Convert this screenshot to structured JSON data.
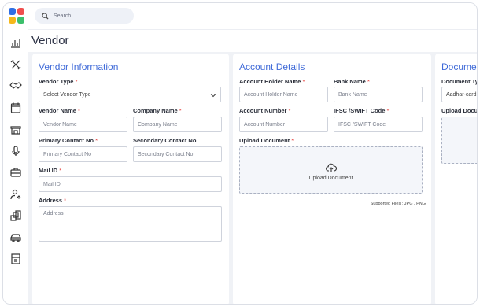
{
  "search": {
    "placeholder": "Search..."
  },
  "page": {
    "title": "Vendor"
  },
  "sidebar": {
    "icons": [
      "bar-chart-icon",
      "tools-icon",
      "handshake-icon",
      "calendar-icon",
      "store-icon",
      "microphone-icon",
      "briefcase-icon",
      "user-settings-icon",
      "coins-icon",
      "car-icon",
      "building-icon"
    ]
  },
  "vendor_info": {
    "title": "Vendor Information",
    "vendor_type_label": "Vendor Type",
    "vendor_type_value": "Select Vendor Type",
    "vendor_name_label": "Vendor Name",
    "vendor_name_placeholder": "Vendor Name",
    "company_name_label": "Company Name",
    "company_name_placeholder": "Company Name",
    "primary_contact_label": "Primary Contact No",
    "primary_contact_placeholder": "Primary Contact No",
    "secondary_contact_label": "Secondary Contact No",
    "secondary_contact_placeholder": "Secondary Contact No",
    "mail_label": "Mail ID",
    "mail_placeholder": "Mail ID",
    "address_label": "Address",
    "address_placeholder": "Address"
  },
  "account": {
    "title": "Account Details",
    "holder_label": "Account Holder Name",
    "holder_placeholder": "Account Holder Name",
    "bank_label": "Bank Name",
    "bank_placeholder": "Bank Name",
    "number_label": "Account Number",
    "number_placeholder": "Account Number",
    "ifsc_label": "IFSC /SWIFT Code",
    "ifsc_placeholder": "IFSC /SWIFT Code",
    "upload_label": "Upload Document",
    "upload_text": "Upload Document",
    "supported": "Supported Files : JPG , PNG"
  },
  "documents": {
    "title": "Documen",
    "type_label": "Document Ty",
    "type_value": "Aadhar-card",
    "upload_label": "Upload Docu"
  },
  "required_mark": "*",
  "colors": {
    "accent": "#3f6ad8",
    "required": "#e53935"
  }
}
